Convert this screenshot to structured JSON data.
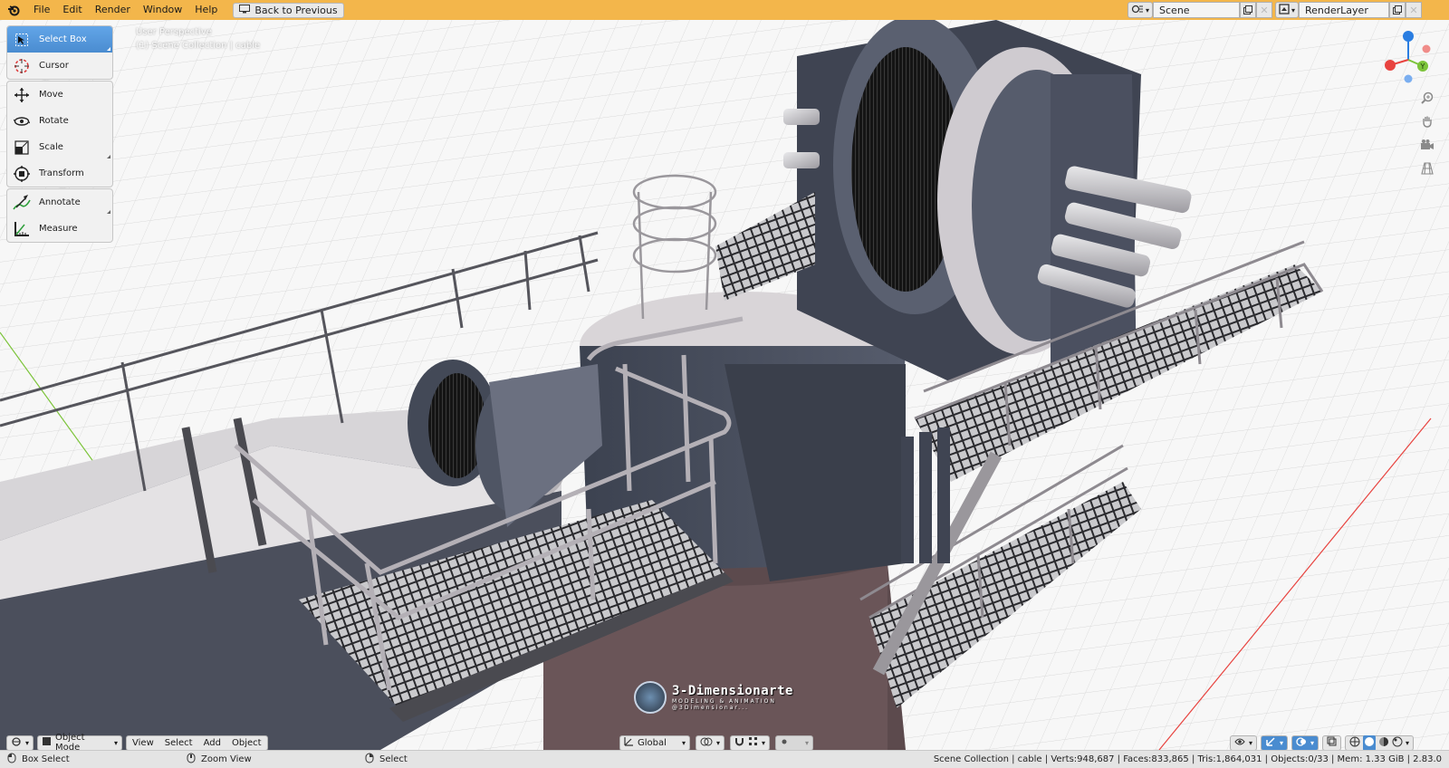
{
  "topbar": {
    "menus": [
      "File",
      "Edit",
      "Render",
      "Window",
      "Help"
    ],
    "back_button": "Back to Previous",
    "scene_name": "Scene",
    "view_layer": "RenderLayer"
  },
  "viewport": {
    "perspective": "User Perspective",
    "collection": "(1) Scene Collection | cable"
  },
  "toolbar": {
    "group1": [
      {
        "label": "Select Box",
        "icon": "select-box-icon",
        "active": true
      },
      {
        "label": "Cursor",
        "icon": "cursor-icon"
      }
    ],
    "group2": [
      {
        "label": "Move",
        "icon": "move-icon"
      },
      {
        "label": "Rotate",
        "icon": "rotate-icon"
      },
      {
        "label": "Scale",
        "icon": "scale-icon"
      },
      {
        "label": "Transform",
        "icon": "transform-icon"
      }
    ],
    "group3": [
      {
        "label": "Annotate",
        "icon": "annotate-icon"
      },
      {
        "label": "Measure",
        "icon": "measure-icon"
      }
    ]
  },
  "header": {
    "mode": "Object Mode",
    "menus": [
      "View",
      "Select",
      "Add",
      "Object"
    ],
    "orientation": "Global"
  },
  "watermark": {
    "title": "3-Dimensionarte",
    "subtitle": "MODELING & ANIMATION",
    "handle": "@3Dimensionar..."
  },
  "statusbar": {
    "left_action": "Box Select",
    "middle_action": "Zoom View",
    "right_action": "Select",
    "stats": "Scene Collection | cable | Verts:948,687 | Faces:833,865 | Tris:1,864,031 | Objects:0/33 | Mem: 1.33 GiB | 2.83.0"
  },
  "colors": {
    "topbar": "#f3b64b",
    "active_tool": "#4a8cd0",
    "axis_x": "#e8433f",
    "axis_y": "#7cc43a",
    "axis_z": "#2a7de1"
  }
}
